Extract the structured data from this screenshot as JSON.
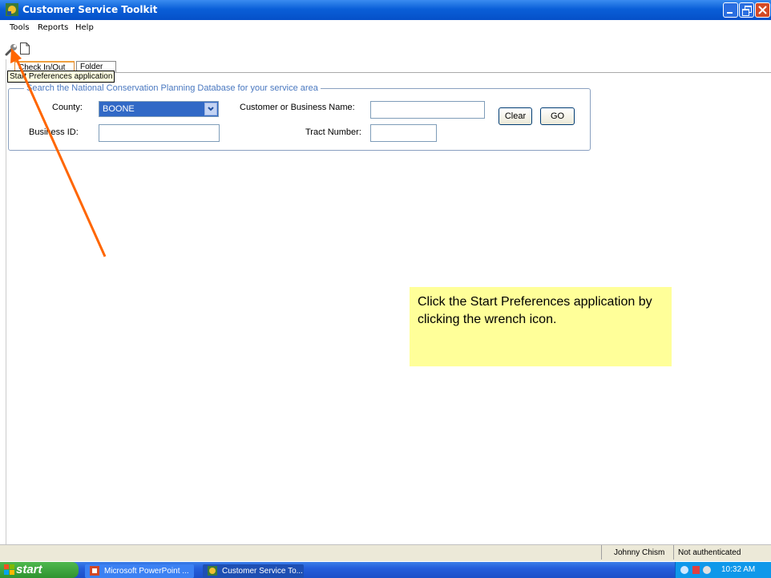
{
  "window": {
    "title": "Customer Service Toolkit"
  },
  "menu": {
    "items": [
      "Tools",
      "Reports",
      "Help"
    ]
  },
  "toolbar": {
    "tooltip": "Start Preferences application"
  },
  "tabs": [
    "Check In/Out",
    "Folder"
  ],
  "search": {
    "legend": "Search the National Conservation Planning Database for your service area",
    "county_label": "County:",
    "county_value": "BOONE",
    "name_label": "Customer or Business Name:",
    "name_value": "",
    "business_id_label": "Business ID:",
    "business_id_value": "",
    "tract_label": "Tract Number:",
    "tract_value": "",
    "clear_label": "Clear",
    "go_label": "GO"
  },
  "callout": {
    "text": "Click the Start Preferences application by clicking the wrench icon."
  },
  "status": {
    "user": "Johnny Chism",
    "auth": "Not authenticated"
  },
  "taskbar": {
    "start_label": "start",
    "tasks": [
      "Microsoft PowerPoint ...",
      "Customer Service To..."
    ],
    "clock": "10:32 AM"
  },
  "colors": {
    "titlebar": "#0a5fd8",
    "callout_bg": "#ffff99",
    "arrow": "#ff6600",
    "selected_field": "#3169c6"
  }
}
